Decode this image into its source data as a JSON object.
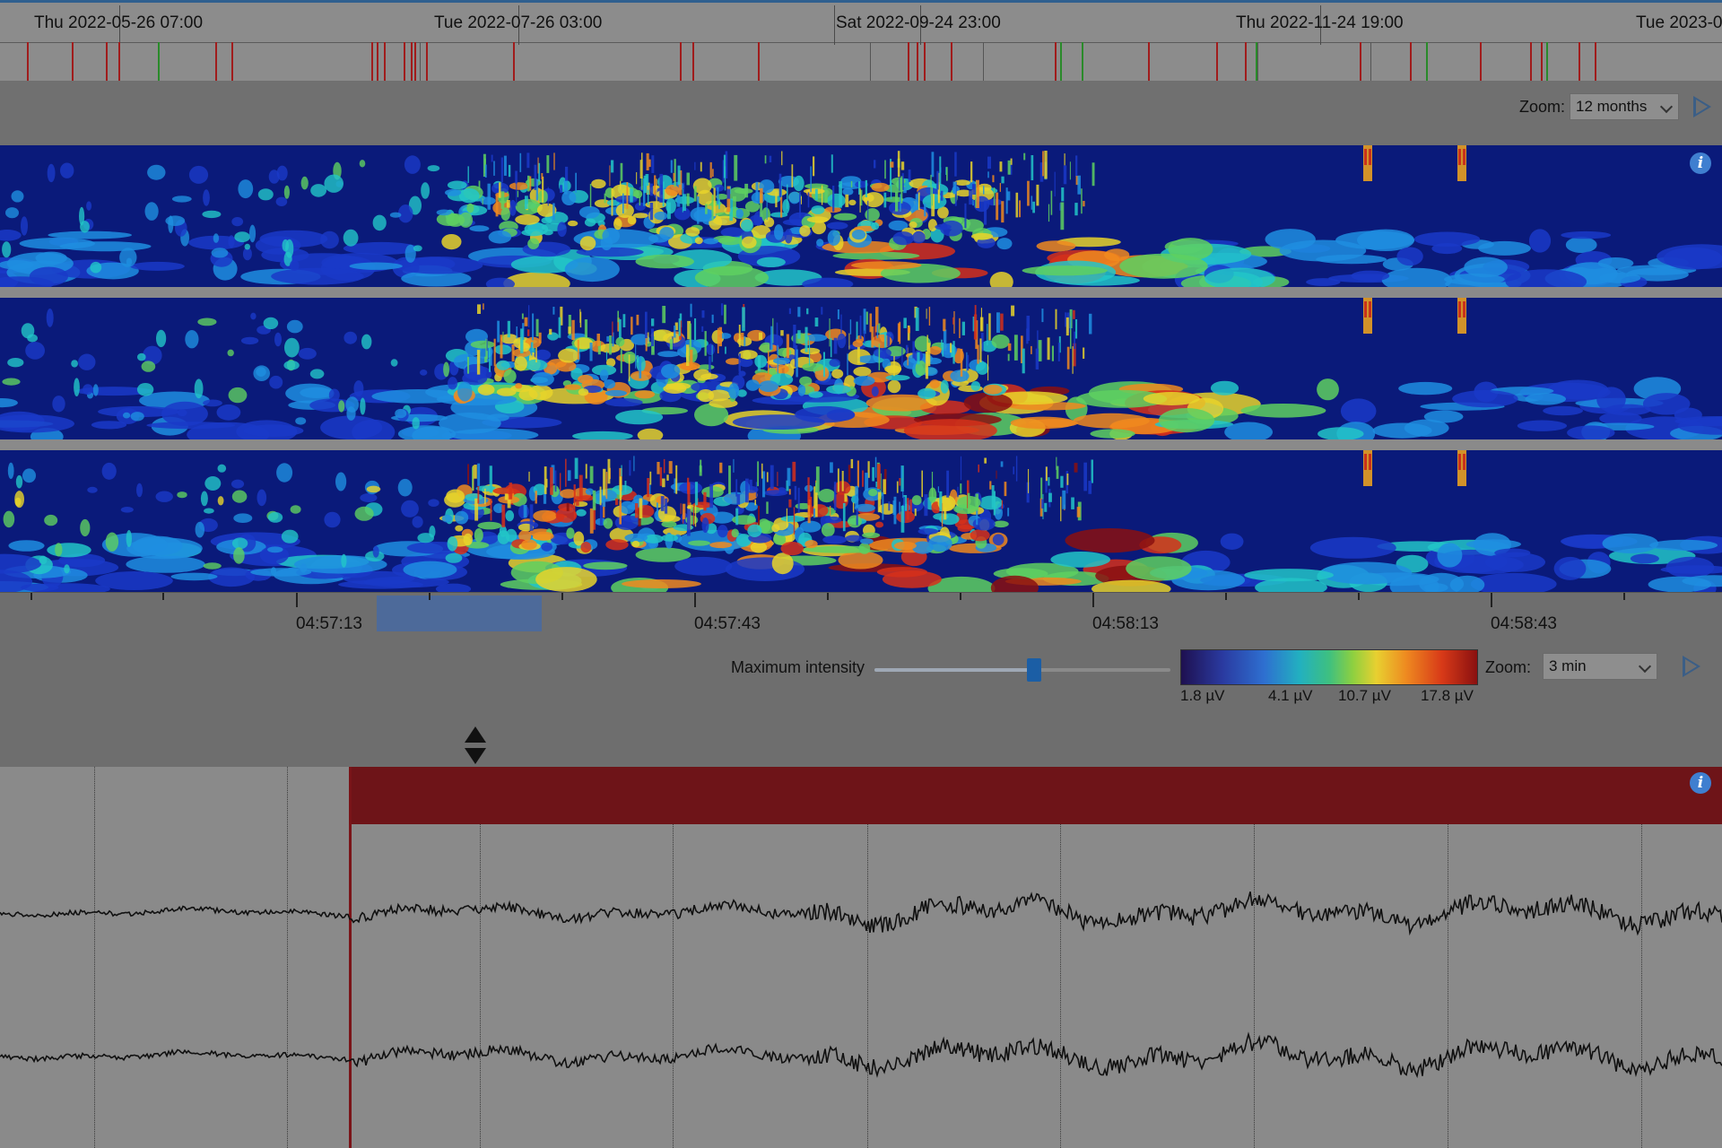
{
  "timeline": {
    "labels": [
      "Thu 2022-05-26 07:00",
      "Tue 2022-07-26 03:00",
      "Sat 2022-09-24 23:00",
      "Thu 2022-11-24 19:00",
      "Tue 2023-0"
    ]
  },
  "top_zoom": {
    "label": "Zoom:",
    "value": "12 months"
  },
  "time_axis": {
    "labels": [
      "04:57:13",
      "04:57:43",
      "04:58:13",
      "04:58:43"
    ]
  },
  "intensity": {
    "label": "Maximum intensity",
    "slider_value_fraction": 0.54,
    "colorbar_labels": [
      "1.8 µV",
      "4.1 µV",
      "10.7 µV",
      "17.8 µV"
    ]
  },
  "bottom_zoom": {
    "label": "Zoom:",
    "value": "3 min"
  },
  "colors": {
    "event_red": "#6e1418",
    "spectrogram_bg": "#0a1a7a",
    "accent_blue": "#1b5ea5",
    "trace": "#111111"
  }
}
